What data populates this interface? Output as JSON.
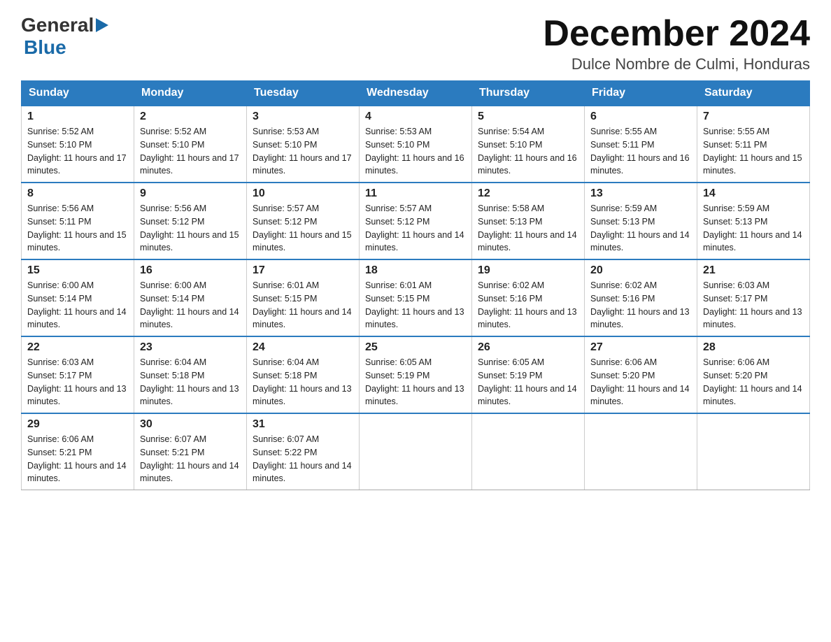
{
  "header": {
    "logo_general": "General",
    "logo_blue": "Blue",
    "title": "December 2024",
    "subtitle": "Dulce Nombre de Culmi, Honduras"
  },
  "calendar": {
    "days_of_week": [
      "Sunday",
      "Monday",
      "Tuesday",
      "Wednesday",
      "Thursday",
      "Friday",
      "Saturday"
    ],
    "weeks": [
      [
        {
          "day": "1",
          "sunrise": "5:52 AM",
          "sunset": "5:10 PM",
          "daylight": "11 hours and 17 minutes."
        },
        {
          "day": "2",
          "sunrise": "5:52 AM",
          "sunset": "5:10 PM",
          "daylight": "11 hours and 17 minutes."
        },
        {
          "day": "3",
          "sunrise": "5:53 AM",
          "sunset": "5:10 PM",
          "daylight": "11 hours and 17 minutes."
        },
        {
          "day": "4",
          "sunrise": "5:53 AM",
          "sunset": "5:10 PM",
          "daylight": "11 hours and 16 minutes."
        },
        {
          "day": "5",
          "sunrise": "5:54 AM",
          "sunset": "5:10 PM",
          "daylight": "11 hours and 16 minutes."
        },
        {
          "day": "6",
          "sunrise": "5:55 AM",
          "sunset": "5:11 PM",
          "daylight": "11 hours and 16 minutes."
        },
        {
          "day": "7",
          "sunrise": "5:55 AM",
          "sunset": "5:11 PM",
          "daylight": "11 hours and 15 minutes."
        }
      ],
      [
        {
          "day": "8",
          "sunrise": "5:56 AM",
          "sunset": "5:11 PM",
          "daylight": "11 hours and 15 minutes."
        },
        {
          "day": "9",
          "sunrise": "5:56 AM",
          "sunset": "5:12 PM",
          "daylight": "11 hours and 15 minutes."
        },
        {
          "day": "10",
          "sunrise": "5:57 AM",
          "sunset": "5:12 PM",
          "daylight": "11 hours and 15 minutes."
        },
        {
          "day": "11",
          "sunrise": "5:57 AM",
          "sunset": "5:12 PM",
          "daylight": "11 hours and 14 minutes."
        },
        {
          "day": "12",
          "sunrise": "5:58 AM",
          "sunset": "5:13 PM",
          "daylight": "11 hours and 14 minutes."
        },
        {
          "day": "13",
          "sunrise": "5:59 AM",
          "sunset": "5:13 PM",
          "daylight": "11 hours and 14 minutes."
        },
        {
          "day": "14",
          "sunrise": "5:59 AM",
          "sunset": "5:13 PM",
          "daylight": "11 hours and 14 minutes."
        }
      ],
      [
        {
          "day": "15",
          "sunrise": "6:00 AM",
          "sunset": "5:14 PM",
          "daylight": "11 hours and 14 minutes."
        },
        {
          "day": "16",
          "sunrise": "6:00 AM",
          "sunset": "5:14 PM",
          "daylight": "11 hours and 14 minutes."
        },
        {
          "day": "17",
          "sunrise": "6:01 AM",
          "sunset": "5:15 PM",
          "daylight": "11 hours and 14 minutes."
        },
        {
          "day": "18",
          "sunrise": "6:01 AM",
          "sunset": "5:15 PM",
          "daylight": "11 hours and 13 minutes."
        },
        {
          "day": "19",
          "sunrise": "6:02 AM",
          "sunset": "5:16 PM",
          "daylight": "11 hours and 13 minutes."
        },
        {
          "day": "20",
          "sunrise": "6:02 AM",
          "sunset": "5:16 PM",
          "daylight": "11 hours and 13 minutes."
        },
        {
          "day": "21",
          "sunrise": "6:03 AM",
          "sunset": "5:17 PM",
          "daylight": "11 hours and 13 minutes."
        }
      ],
      [
        {
          "day": "22",
          "sunrise": "6:03 AM",
          "sunset": "5:17 PM",
          "daylight": "11 hours and 13 minutes."
        },
        {
          "day": "23",
          "sunrise": "6:04 AM",
          "sunset": "5:18 PM",
          "daylight": "11 hours and 13 minutes."
        },
        {
          "day": "24",
          "sunrise": "6:04 AM",
          "sunset": "5:18 PM",
          "daylight": "11 hours and 13 minutes."
        },
        {
          "day": "25",
          "sunrise": "6:05 AM",
          "sunset": "5:19 PM",
          "daylight": "11 hours and 13 minutes."
        },
        {
          "day": "26",
          "sunrise": "6:05 AM",
          "sunset": "5:19 PM",
          "daylight": "11 hours and 14 minutes."
        },
        {
          "day": "27",
          "sunrise": "6:06 AM",
          "sunset": "5:20 PM",
          "daylight": "11 hours and 14 minutes."
        },
        {
          "day": "28",
          "sunrise": "6:06 AM",
          "sunset": "5:20 PM",
          "daylight": "11 hours and 14 minutes."
        }
      ],
      [
        {
          "day": "29",
          "sunrise": "6:06 AM",
          "sunset": "5:21 PM",
          "daylight": "11 hours and 14 minutes."
        },
        {
          "day": "30",
          "sunrise": "6:07 AM",
          "sunset": "5:21 PM",
          "daylight": "11 hours and 14 minutes."
        },
        {
          "day": "31",
          "sunrise": "6:07 AM",
          "sunset": "5:22 PM",
          "daylight": "11 hours and 14 minutes."
        },
        null,
        null,
        null,
        null
      ]
    ]
  }
}
